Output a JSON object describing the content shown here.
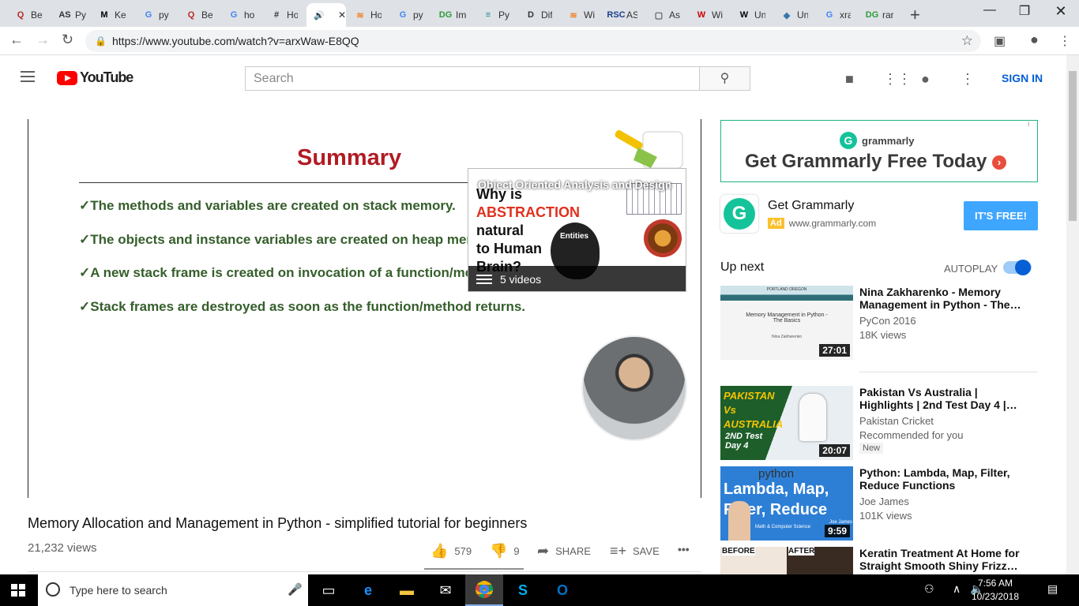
{
  "browser": {
    "tabs": [
      {
        "icon": "Q",
        "label": "Be",
        "color": "#b92b27"
      },
      {
        "icon": "AS",
        "label": "Py",
        "color": "#333"
      },
      {
        "icon": "M",
        "label": "Ke",
        "color": "#000"
      },
      {
        "icon": "G",
        "label": "py",
        "color": "#4285f4"
      },
      {
        "icon": "Q",
        "label": "Be",
        "color": "#b92b27"
      },
      {
        "icon": "G",
        "label": "ho",
        "color": "#4285f4"
      },
      {
        "icon": "#",
        "label": "Ho",
        "color": "#333"
      },
      {
        "icon": "🔊",
        "label": "",
        "color": "#333"
      },
      {
        "icon": "≋",
        "label": "Ho",
        "color": "#f48024"
      },
      {
        "icon": "G",
        "label": "py",
        "color": "#4285f4"
      },
      {
        "icon": "DG",
        "label": "Im",
        "color": "#2c9c3a"
      },
      {
        "icon": "≡",
        "label": "Py",
        "color": "#1a8a8a"
      },
      {
        "icon": "D",
        "label": "Dif",
        "color": "#333"
      },
      {
        "icon": "≋",
        "label": "Wi",
        "color": "#f48024"
      },
      {
        "icon": "RSC",
        "label": "AS",
        "color": "#1d3f8a"
      },
      {
        "icon": "▢",
        "label": "As",
        "color": "#555"
      },
      {
        "icon": "W",
        "label": "Wi",
        "color": "#c00"
      },
      {
        "icon": "W",
        "label": "Un",
        "color": "#000"
      },
      {
        "icon": "◆",
        "label": "Un",
        "color": "#3776ab"
      },
      {
        "icon": "G",
        "label": "xra",
        "color": "#4285f4"
      },
      {
        "icon": "DG",
        "label": "rar",
        "color": "#2c9c3a"
      }
    ],
    "url": "https://www.youtube.com/watch?v=arxWaw-E8QQ"
  },
  "masthead": {
    "logo_text": "YouTube",
    "search_placeholder": "Search",
    "signin": "SIGN IN"
  },
  "slide": {
    "title": "Summary",
    "bullets": [
      "✓The methods and variables are created on stack memory.",
      "✓The objects and instance variables are created on heap memory.",
      "✓A new stack frame is created on invocation of a function/method.",
      "✓Stack frames are destroyed as soon as the function/method returns."
    ]
  },
  "card": {
    "title": "Object Oriented Analysis and Design",
    "line1": "Why is",
    "line2": "ABSTRACTION",
    "line3": "natural",
    "line4": "to Human",
    "line5": "Brain?",
    "entities": "Entities",
    "videos": "5 videos"
  },
  "video": {
    "title": "Memory Allocation and Management in Python - simplified tutorial for beginners",
    "views": "21,232 views",
    "likes": "579",
    "dislikes": "9",
    "share": "SHARE",
    "save": "SAVE",
    "more": "•••"
  },
  "ad": {
    "brand": "grammarly",
    "headline": "Get Grammarly Free Today",
    "info": "i",
    "name": "Get Grammarly",
    "badge": "Ad",
    "domain": "www.grammarly.com",
    "cta": "IT'S FREE!"
  },
  "sidebar": {
    "upnext": "Up next",
    "autoplay": "AUTOPLAY",
    "recs": [
      {
        "title": "Nina Zakharenko - Memory Management in Python - The…",
        "channel": "PyCon 2016",
        "views": "18K views",
        "duration": "27:01"
      },
      {
        "title": "Pakistan Vs Australia | Highlights | 2nd Test Day 4 |…",
        "channel": "Pakistan Cricket",
        "views": "Recommended for you",
        "duration": "20:07",
        "badge": "New"
      },
      {
        "title": "Python: Lambda, Map, Filter, Reduce Functions",
        "channel": "Joe James",
        "views": "101K views",
        "duration": "9:59"
      },
      {
        "title": "Keratin Treatment At Home for Straight Smooth Shiny Frizz…",
        "channel": "",
        "views": "",
        "duration": ""
      }
    ],
    "thumb_text": {
      "nina_title": "Memory Management in Python - The Basics",
      "nina_name": "Nina Zakharenko",
      "nina_event": "PORTLAND OREGON",
      "pak1": "PAKISTAN",
      "pak2": "Vs",
      "pak3": "AUSTRALIA",
      "pak4": "2ND Test",
      "pak5": "Day 4",
      "py_brand": "python",
      "py_l1": "Lambda, Map,",
      "py_l2": "Filter, Reduce",
      "py_sub": "Math & Computer Science",
      "py_name": "Joe James",
      "before": "BEFORE",
      "after": "AFTER"
    }
  },
  "taskbar": {
    "search_placeholder": "Type here to search",
    "time": "7:56 AM",
    "date": "10/23/2018"
  }
}
